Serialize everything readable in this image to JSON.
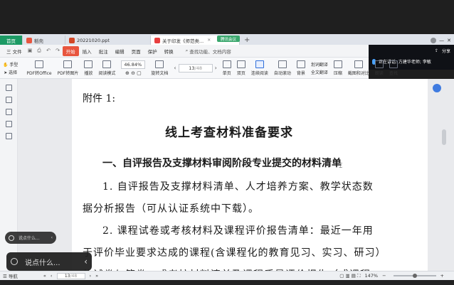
{
  "tabs": {
    "home": "首页",
    "daoke": "稻壳",
    "ppt": "20221020.ppt",
    "pdf": "关于印发《师范类...",
    "share_overlay": "腾讯会议"
  },
  "menu": {
    "file": "三 文件",
    "start": "开始",
    "items": [
      "插入",
      "批注",
      "编辑",
      "页面",
      "保护",
      "转换"
    ],
    "search": "查找功能、文档内容",
    "share": "分享"
  },
  "chat": {
    "speaking": "正在讲话: 方建华老师; 李敏"
  },
  "toolbar": {
    "hand": "手型",
    "select": "选择",
    "pdf_to_office": "PDF转Office",
    "pdf_to_image": "PDF转图片",
    "play": "播放",
    "read_mode": "阅读模式",
    "zoom": "46.84%",
    "rotate": "旋转文档",
    "page_value": "13",
    "page_total": "/48",
    "single": "单页",
    "double": "双页",
    "continuous": "连续阅读",
    "auto_scroll": "自动滚动",
    "background": "背景",
    "translate": "划词翻译",
    "full_translate": "全文翻译",
    "compress": "压缩",
    "screenshot": "截图和对比",
    "read_aloud": "朗读",
    "find": "查找"
  },
  "document": {
    "attachment": "附件 1:",
    "title": "线上考查材料准备要求",
    "section1": "一、自评报告及支撑材料审阅阶段专业提交的材料清单",
    "item1_line1": "1. 自评报告及支撑材料清单、人才培养方案、教学状态数",
    "item1_line2": "据分析报告（可从认证系统中下载）。",
    "item2_line1": "2. 课程试卷或考核材料及课程评价报告清单：最近一年用",
    "item2_line2": "于评价毕业要求达成的课程(含课程化的教育见习、实习、研习）",
    "item2_line3": "的试卷与答卷，或考核材料清单及课程质量评价报告（或课程"
  },
  "chat_input": {
    "small_placeholder": "说点什么...",
    "placeholder": "说点什么..."
  },
  "status": {
    "nav": "导航",
    "page_value": "13",
    "page_total": "/48",
    "zoom": "147%",
    "zoom_fraction": 0.5
  }
}
